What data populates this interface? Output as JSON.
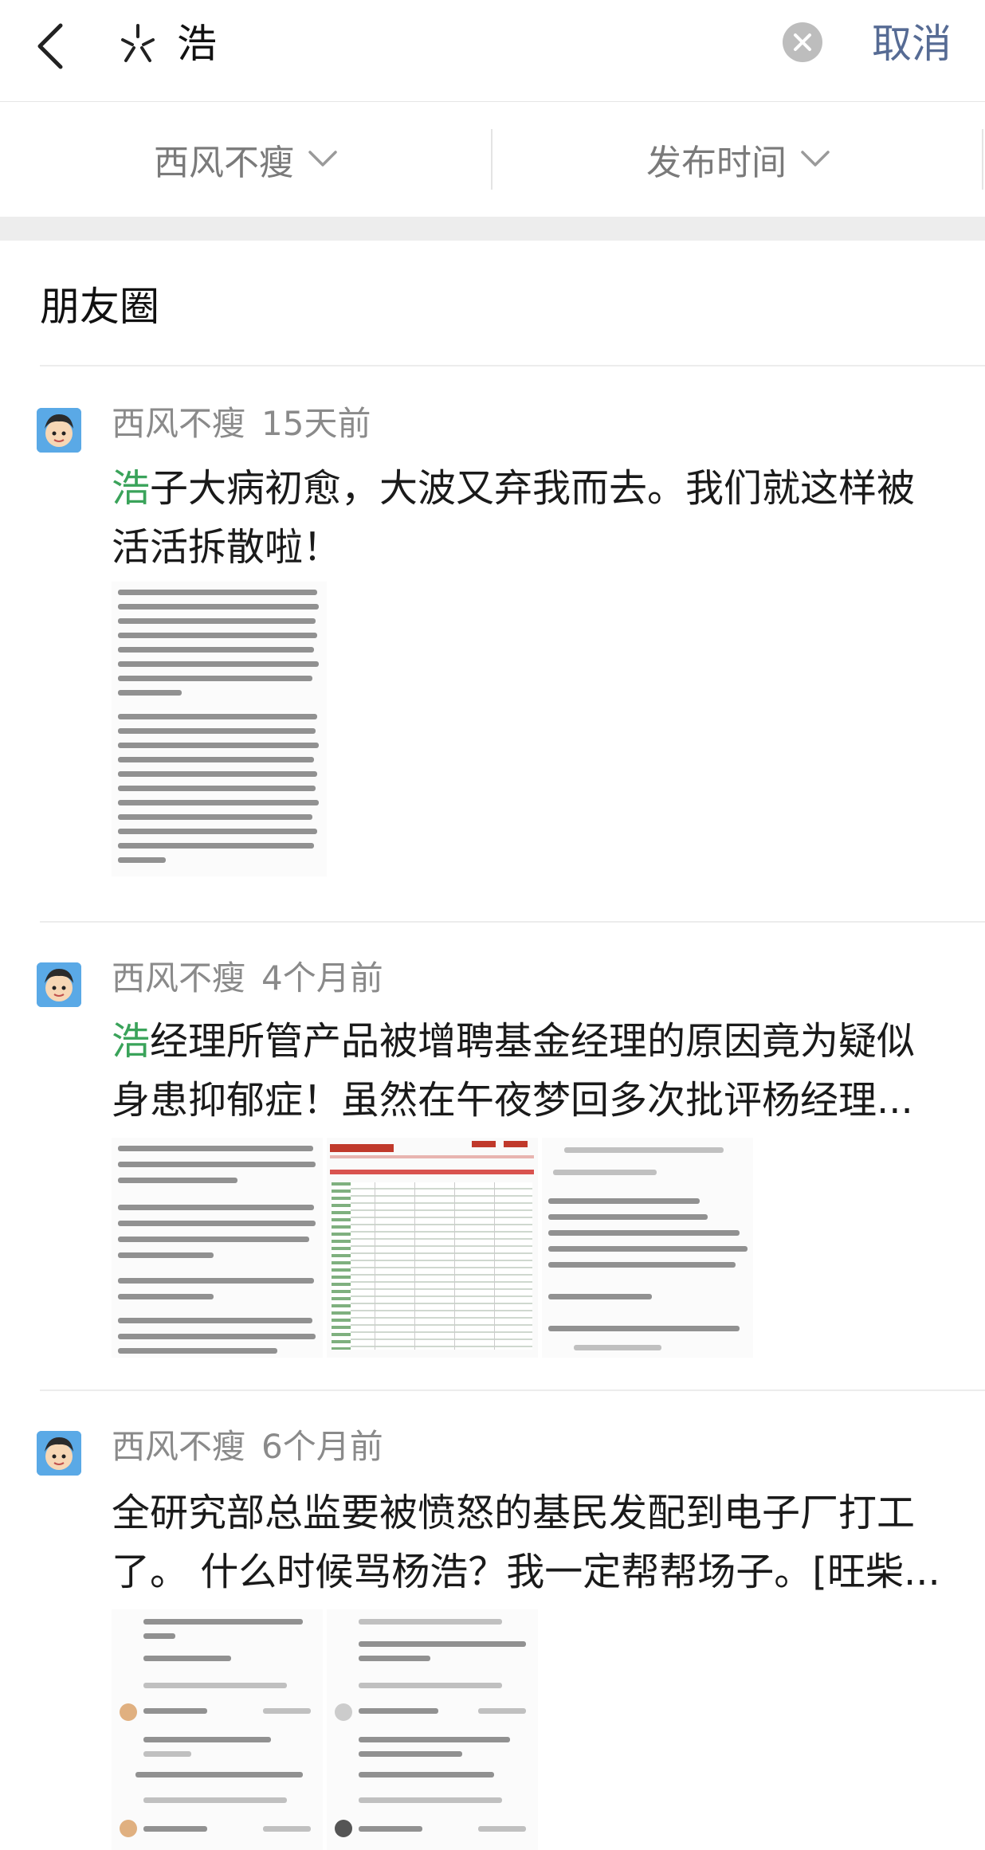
{
  "search": {
    "query": "浩",
    "cancel_label": "取消"
  },
  "filters": {
    "author_label": "西风不瘦",
    "time_label": "发布时间"
  },
  "section": {
    "title": "朋友圈"
  },
  "posts": [
    {
      "author": "西风不瘦",
      "time": "15天前",
      "highlight": "浩",
      "text_line1": "子大病初愈，大波又弃我而去。我们就这样被",
      "text_line2": "活活拆散啦！"
    },
    {
      "author": "西风不瘦",
      "time": "4个月前",
      "highlight": "浩",
      "text_line1": "经理所管产品被增聘基金经理的原因竟为疑似",
      "text_line2": "身患抑郁症！虽然在午夜梦回多次批评杨经理..."
    },
    {
      "author": "西风不瘦",
      "time": "6个月前",
      "highlight": "",
      "text_line1": "全研究部总监要被愤怒的基民发配到电子厂打工",
      "text_line2": "了。 什么时候骂杨浩？我一定帮帮场子。[旺柴..."
    }
  ],
  "colors": {
    "highlight_green": "#3aa35a",
    "cancel_blue": "#566b94",
    "meta_gray": "#8a8a8a"
  },
  "icons": {
    "back": "chevron-left-icon",
    "app": "sparkle-icon",
    "clear": "close-circle-icon",
    "dropdown": "chevron-down-icon"
  }
}
